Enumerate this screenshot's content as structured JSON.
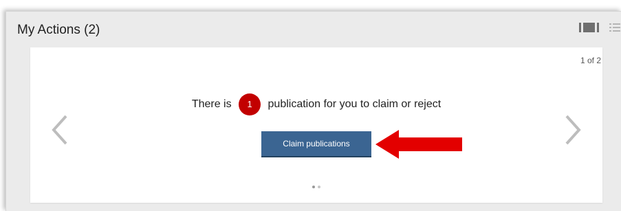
{
  "panel": {
    "title": "My Actions (2)",
    "view_icons": [
      "card-view-icon",
      "list-view-icon"
    ]
  },
  "card": {
    "page_indicator": "1 of 2",
    "message_prefix": "There is",
    "badge_count": "1",
    "message_suffix": "publication for you to claim or reject",
    "button_label": "Claim publications",
    "nav_icons": [
      "chevron-left-icon",
      "chevron-right-icon"
    ],
    "pagination": {
      "total": 2,
      "active": 1
    }
  },
  "colors": {
    "panel_bg": "#ebebeb",
    "card_bg": "#ffffff",
    "button_bg": "#3b6592",
    "badge_bg": "#c20000",
    "callout_arrow": "#e30000",
    "chevron": "#bdbdbd"
  }
}
